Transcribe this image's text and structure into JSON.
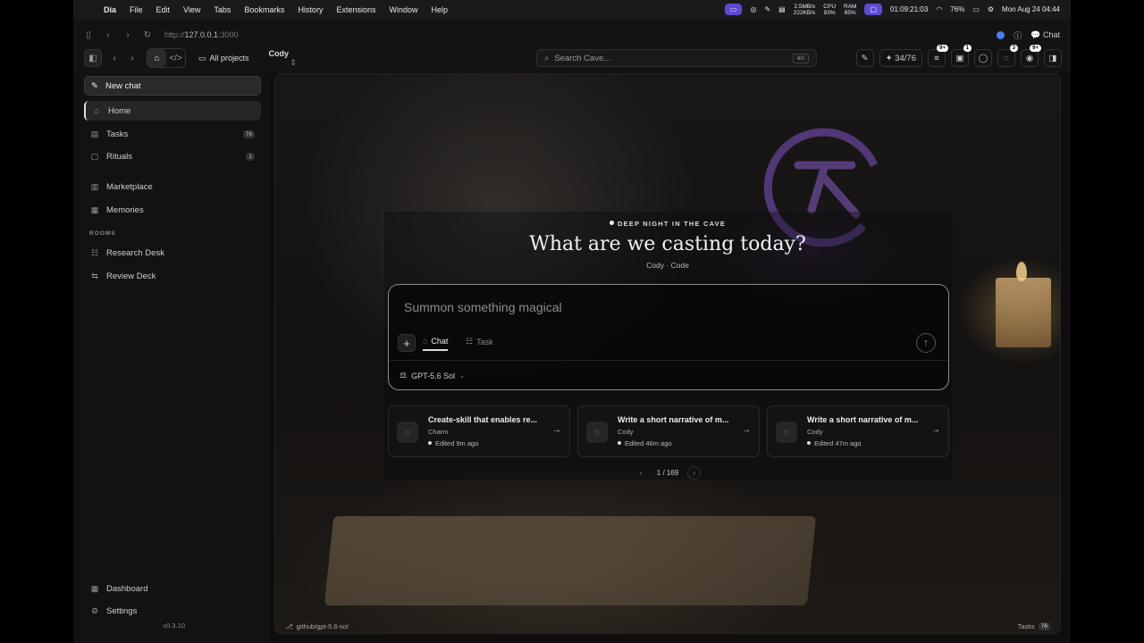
{
  "menubar": {
    "app": "Dia",
    "items": [
      "File",
      "Edit",
      "View",
      "Tabs",
      "Bookmarks",
      "History",
      "Extensions",
      "Window",
      "Help"
    ],
    "net_up": "2.5MB/s",
    "net_down": "222KB/s",
    "cpu_label": "CPU",
    "cpu": "93%",
    "ram_label": "RAM",
    "ram": "85%",
    "timer": "01:09:21:03",
    "battery": "76%",
    "datetime": "Mon Aug 24  04:44"
  },
  "browser": {
    "url_scheme": "http://",
    "url_host": "127.0.0.1",
    "url_port": ":3000",
    "chat_label": "Chat"
  },
  "toolbar": {
    "project_label": "All projects",
    "workspace": "Cody",
    "search_placeholder": "Search Cave...",
    "search_shortcut": "⌘K",
    "progress": "34/76",
    "badge_a": "9+",
    "badge_b": "1",
    "badge_c": "3",
    "badge_d": "9+"
  },
  "sidebar": {
    "new_chat": "New chat",
    "items": [
      {
        "label": "Home",
        "icon": "home-icon"
      },
      {
        "label": "Tasks",
        "count": "76"
      },
      {
        "label": "Rituals",
        "count": "1"
      },
      {
        "label": "Marketplace"
      },
      {
        "label": "Memories"
      }
    ],
    "rooms_heading": "ROOMS",
    "rooms": [
      {
        "label": "Research Desk"
      },
      {
        "label": "Review Deck"
      }
    ],
    "bottom": [
      {
        "label": "Dashboard"
      },
      {
        "label": "Settings"
      }
    ],
    "version": "v0.3.10"
  },
  "hero": {
    "eyebrow": "DEEP NIGHT IN THE CAVE",
    "headline": "What are we casting today?",
    "subline": "Cody · Code"
  },
  "composer": {
    "placeholder": "Summon something magical",
    "tab_chat": "Chat",
    "tab_task": "Task",
    "model": "GPT-5.6 Sol"
  },
  "cards": [
    {
      "title": "Create-skill that enables re...",
      "author": "Charm",
      "edited": "Edited 9m ago"
    },
    {
      "title": "Write a short narrative of m...",
      "author": "Cody",
      "edited": "Edited 46m ago"
    },
    {
      "title": "Write a short narrative of m...",
      "author": "Cody",
      "edited": "Edited 47m ago"
    }
  ],
  "pager": {
    "text": "1 / 169"
  },
  "footer": {
    "branch": "github/gpt-5.6-sol",
    "tasks_label": "Tasks",
    "tasks_count": "76"
  },
  "colors": {
    "accent": "#5b4bd1",
    "logo": "#8a5cc8"
  }
}
